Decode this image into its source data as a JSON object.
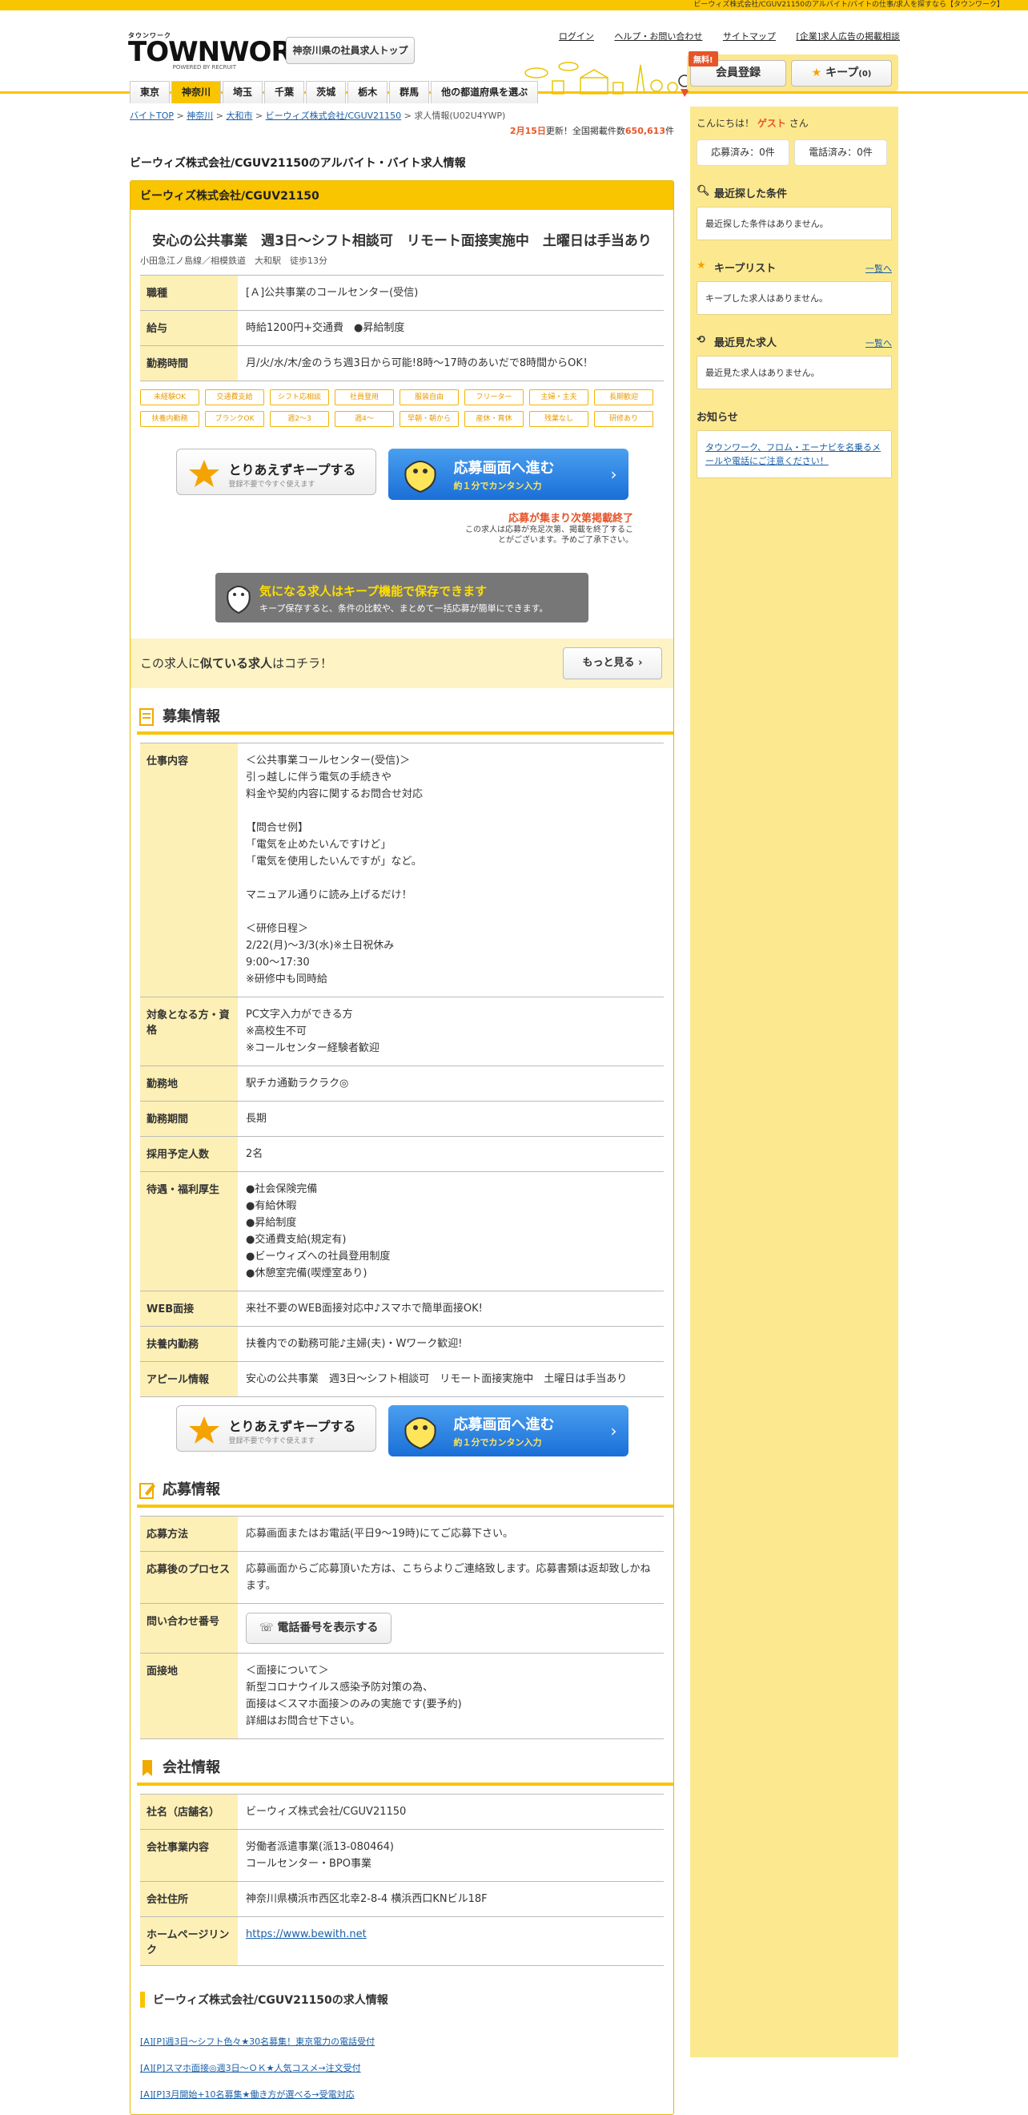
{
  "topbar_text": "ビーウィズ株式会社/CGUV21150のアルバイト/バイトの仕事/求人を探すなら【タウンワーク】",
  "logo": {
    "small": "タウンワーク",
    "big": "TOWNWORK",
    "powered": "POWERED BY RECRUIT"
  },
  "header_button": "神奈川県の社員求人トップ",
  "header_links": [
    "ログイン",
    "ヘルプ・お問い合わせ",
    "サイトマップ",
    "[企業]求人広告の掲載相談"
  ],
  "free_badge": "無料!",
  "member_button": "会員登録",
  "keep_button": "キープ",
  "keep_count": "(0)",
  "nav_tabs": [
    "東京",
    "神奈川",
    "埼玉",
    "千葉",
    "茨城",
    "栃木",
    "群馬",
    "他の都道府県を選ぶ"
  ],
  "breadcrumb": [
    "バイトTOP",
    "神奈川",
    "大和市",
    "ビーウィズ株式会社/CGUV21150",
    "求人情報(U02U4YWP)"
  ],
  "update": {
    "date": "2月15日",
    "text1": "更新！全国掲載件数",
    "count": "650,613",
    "text2": "件"
  },
  "page_title": "ビーウィズ株式会社/CGUV21150のアルバイト・バイト求人情報",
  "company_name": "ビーウィズ株式会社/CGUV21150",
  "catch_copy": "安心の公共事業　週3日～シフト相談可　リモート面接実施中　土曜日は手当あり",
  "access": "小田急江ノ島線／相模鉄道　大和駅　徒歩13分",
  "summary": [
    {
      "label": "職種",
      "value": "[Ａ]公共事業のコールセンター(受信)"
    },
    {
      "label": "給与",
      "value": "時給1200円+交通費　●昇給制度"
    },
    {
      "label": "勤務時間",
      "value": "月/火/水/木/金のうち週3日から可能!8時～17時のあいだで8時間からOK！"
    }
  ],
  "tags": [
    "未経験OK",
    "交通費支給",
    "シフト応相談",
    "社員登用",
    "服装自由",
    "フリーター",
    "主婦・主夫",
    "長期歓迎",
    "扶養内勤務",
    "ブランクOK",
    "週2～3",
    "週4～",
    "早朝・朝から",
    "産休・育休",
    "残業なし",
    "研修あり"
  ],
  "keep_btn": {
    "title": "とりあえずキープする",
    "sub": "登録不要で今すぐ使えます"
  },
  "apply_btn": {
    "title": "応募画面へ進む",
    "sub": "約１分でカンタン入力"
  },
  "closing": {
    "title": "応募が集まり次第掲載終了",
    "text": "この求人は応募が充足次第、掲載を終了することがございます。予めご了承下さい。"
  },
  "keep_banner": {
    "title": "気になる求人はキープ機能で保存できます",
    "text": "キープ保存すると、条件の比較や、まとめて一括応募が簡単にできます。"
  },
  "similar": {
    "prefix": "この求人に",
    "bold": "似ている求人",
    "suffix": "はコチラ！",
    "button": "もっと見る"
  },
  "recruit_heading": "募集情報",
  "recruit": [
    {
      "label": "仕事内容",
      "value": "＜公共事業コールセンター(受信)＞\n引っ越しに伴う電気の手続きや\n料金や契約内容に関するお問合せ対応\n\n【問合せ例】\n「電気を止めたいんですけど」\n「電気を使用したいんですが」など。\n\nマニュアル通りに読み上げるだけ！\n\n＜研修日程＞\n2/22(月)～3/3(水)※土日祝休み\n9:00～17:30\n※研修中も同時給"
    },
    {
      "label": "対象となる方・資格",
      "value": "PC文字入力ができる方\n※高校生不可\n※コールセンター経験者歓迎"
    },
    {
      "label": "勤務地",
      "value": "駅チカ通勤ラクラク◎"
    },
    {
      "label": "勤務期間",
      "value": "長期"
    },
    {
      "label": "採用予定人数",
      "value": "2名"
    },
    {
      "label": "待遇・福利厚生",
      "value": "●社会保険完備\n●有給休暇\n●昇給制度\n●交通費支給(規定有)\n●ビーウィズへの社員登用制度\n●休憩室完備(喫煙室あり)"
    },
    {
      "label": "WEB面接",
      "value": "来社不要のWEB面接対応中♪スマホで簡単面接OK!"
    },
    {
      "label": "扶養内勤務",
      "value": "扶養内での勤務可能♪主婦(夫)・Wワーク歓迎!"
    },
    {
      "label": "アピール情報",
      "value": "安心の公共事業　週3日～シフト相談可　リモート面接実施中　土曜日は手当あり"
    }
  ],
  "apply_heading": "応募情報",
  "apply_info": [
    {
      "label": "応募方法",
      "value": "応募画面またはお電話(平日9～19時)にてご応募下さい。"
    },
    {
      "label": "応募後のプロセス",
      "value": "応募画面からご応募頂いた方は、こちらよりご連絡致します。応募書類は返却致しかねます。"
    },
    {
      "label": "問い合わせ番号",
      "value": ""
    },
    {
      "label": "面接地",
      "value": "＜面接について＞\n新型コロナウイルス感染予防対策の為、\n面接は＜スマホ面接＞のみの実施です(要予約)\n詳細はお問合せ下さい。"
    }
  ],
  "tel_button": "電話番号を表示する",
  "company_heading": "会社情報",
  "company_info": [
    {
      "label": "社名（店舗名）",
      "value": "ビーウィズ株式会社/CGUV21150"
    },
    {
      "label": "会社事業内容",
      "value": "労働者派遣事業(派13-080464)\nコールセンター・BPO事業"
    },
    {
      "label": "会社住所",
      "value": "神奈川県横浜市西区北幸2-8-4 横浜西口KNビル18F"
    },
    {
      "label": "ホームページリンク",
      "value": "https://www.bewith.net"
    }
  ],
  "company_jobs_heading": "ビーウィズ株式会社/CGUV21150の求人情報",
  "company_jobs": [
    "[A][P]週3日～シフト色々★30名募集！東京電力の電話受付",
    "[A][P]スマホ面接◎週3日～ＯＫ★人気コスメ→注文受付",
    "[A][P]3月開始+10名募集★働き方が選べる→受電対応"
  ],
  "side": {
    "greet_prefix": "こんにちは！",
    "guest": "ゲスト",
    "greet_suffix": "さん",
    "applied": "応募済み：0件",
    "called": "電話済み：0件",
    "recent_cond_title": "最近探した条件",
    "recent_cond_text": "最近探した条件はありません。",
    "keeplist_title": "キープリスト",
    "keeplist_more": "一覧へ",
    "keeplist_text": "キープした求人はありません。",
    "recent_view_title": "最近見た求人",
    "recent_view_more": "一覧へ",
    "recent_view_text": "最近見た求人はありません。",
    "notice_title": "お知らせ",
    "notice_text": "タウンワーク、フロム・エーナビを名乗るメールや電話にご注意ください！"
  },
  "colors": {
    "brand_yellow": "#f9c400",
    "accent_orange": "#e6552a",
    "link_blue": "#1a5fa8",
    "apply_blue": "#1a6fd8"
  }
}
